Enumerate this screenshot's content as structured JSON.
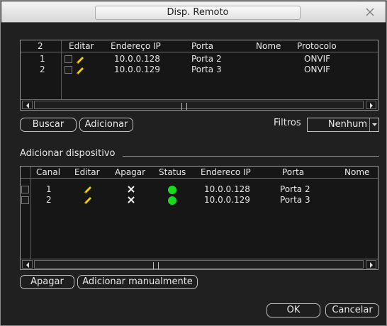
{
  "window": {
    "title": "Disp. Remoto"
  },
  "remote_table": {
    "headers": [
      "2",
      "Editar",
      "Endereço IP",
      "Porta",
      "Nome",
      "Protocolo"
    ],
    "rows": [
      {
        "num": "1",
        "ip": "10.0.0.128",
        "port": "Porta 2",
        "name": "",
        "protocol": "ONVIF"
      },
      {
        "num": "2",
        "ip": "10.0.0.129",
        "port": "Porta 3",
        "name": "",
        "protocol": "ONVIF"
      }
    ]
  },
  "search_controls": {
    "search_label": "Buscar",
    "add_label": "Adicionar",
    "filters_label": "Filtros",
    "filter_value": "Nenhum"
  },
  "added_section": {
    "title": "Adicionar dispositivo",
    "headers": [
      "Canal",
      "Editar",
      "Apagar",
      "Status",
      "Endereco IP",
      "Porta",
      "Nome"
    ],
    "rows": [
      {
        "channel": "1",
        "ip": "10.0.0.128",
        "port": "Porta 2",
        "name": "",
        "status_color": "#18d91e"
      },
      {
        "channel": "2",
        "ip": "10.0.0.129",
        "port": "Porta 3",
        "name": "",
        "status_color": "#18d91e"
      }
    ],
    "delete_label": "Apagar",
    "manual_add_label": "Adicionar manualmente"
  },
  "footer": {
    "ok_label": "OK",
    "cancel_label": "Cancelar"
  },
  "icons": {
    "edit": "pencil-icon",
    "delete": "x-icon",
    "status": "status-dot-icon",
    "close": "close-icon"
  }
}
